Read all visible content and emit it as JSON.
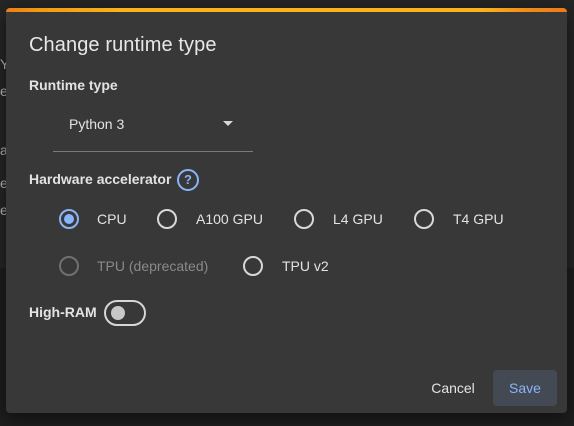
{
  "background": {
    "fragments": [
      "Y",
      "e",
      "a",
      "el",
      "e"
    ]
  },
  "dialog": {
    "title": "Change runtime type",
    "runtime_type": {
      "label": "Runtime type",
      "selected": "Python 3"
    },
    "hardware_accelerator": {
      "label": "Hardware accelerator",
      "help_icon": "help-icon",
      "help_glyph": "?",
      "options": [
        {
          "label": "CPU",
          "checked": true,
          "disabled": false
        },
        {
          "label": "A100 GPU",
          "checked": false,
          "disabled": false
        },
        {
          "label": "L4 GPU",
          "checked": false,
          "disabled": false
        },
        {
          "label": "T4 GPU",
          "checked": false,
          "disabled": false
        },
        {
          "label": "TPU (deprecated)",
          "checked": false,
          "disabled": true
        },
        {
          "label": "TPU v2",
          "checked": false,
          "disabled": false
        }
      ]
    },
    "high_ram": {
      "label": "High-RAM",
      "enabled": false
    },
    "buttons": {
      "cancel": "Cancel",
      "save": "Save"
    }
  },
  "colors": {
    "accent": "#8ab4f8",
    "top_bar": "#f9b21a",
    "dialog_bg": "#383838"
  }
}
